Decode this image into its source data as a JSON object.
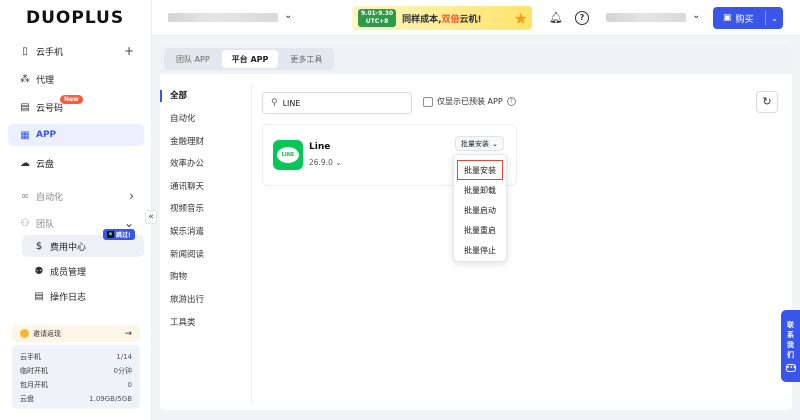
{
  "logo": "DUOPLUS",
  "sidebar": {
    "items": [
      {
        "label": "云手机",
        "icon": "phone-icon"
      },
      {
        "label": "代理",
        "icon": "network-icon"
      },
      {
        "label": "云号码",
        "icon": "sim-icon",
        "badge": "New"
      },
      {
        "label": "APP",
        "icon": "grid-icon"
      },
      {
        "label": "云盘",
        "icon": "cloud-icon"
      }
    ],
    "add_symbol": "+",
    "automation": "自动化",
    "team": "团队",
    "team_sub": [
      {
        "label": "费用中心",
        "icon": "dollar-icon"
      },
      {
        "label": "成员管理",
        "icon": "members-icon"
      },
      {
        "label": "操作日志",
        "icon": "log-icon"
      }
    ],
    "jump_tag": "跳过!",
    "invite": "邀请返现",
    "stats": [
      {
        "label": "云手机",
        "value": "1/14"
      },
      {
        "label": "临时开机",
        "value": "0分钟"
      },
      {
        "label": "包月开机",
        "value": "0"
      },
      {
        "label": "云盘",
        "value": "1.09GB/5GB"
      }
    ]
  },
  "header": {
    "promo_date": "9.01-9.30",
    "promo_tz": "UTC+8",
    "promo_text_a": "同样成本,",
    "promo_text_hl": "双倍",
    "promo_text_b": "云机!",
    "buy_label": "购买"
  },
  "tabs": [
    "团队 APP",
    "平台 APP",
    "更多工具"
  ],
  "active_tab": 1,
  "categories": [
    "全部",
    "自动化",
    "金融理财",
    "效率办公",
    "通讯聊天",
    "视频音乐",
    "娱乐消遣",
    "新闻阅读",
    "购物",
    "旅游出行",
    "工具类"
  ],
  "search": {
    "value": "LINE"
  },
  "preinstalled_label": "仅显示已预装 APP",
  "app": {
    "name": "Line",
    "version": "26.9.0",
    "logo_text": "LINE",
    "batch_label": "批量安装"
  },
  "dropdown": [
    "批量安装",
    "批量卸载",
    "批量启动",
    "批量重启",
    "批量停止"
  ],
  "contact": [
    "联",
    "系",
    "我",
    "们"
  ],
  "colors": {
    "accent": "#3a56e8",
    "line_green": "#06c755",
    "highlight": "#e2473a"
  }
}
